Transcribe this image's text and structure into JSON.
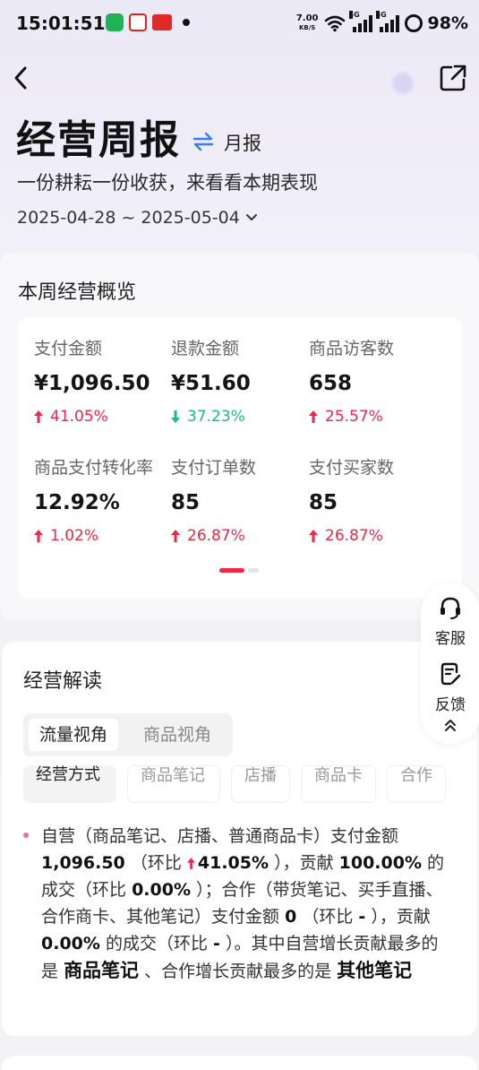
{
  "status_bar": {
    "time": "15:01:51",
    "speed_value": "7.00",
    "speed_unit": "KB/S",
    "network_1": "5G",
    "network_2": "5G",
    "battery": "98%"
  },
  "header": {
    "title": "经营周报",
    "switch_label": "月报",
    "subtitle": "一份耕耘一份收获，来看看本期表现",
    "date_range": "2025-04-28 ~ 2025-05-04"
  },
  "overview": {
    "title": "本周经营概览",
    "metrics": [
      {
        "label": "支付金额",
        "value": "¥1,096.50",
        "change": "41.05%",
        "direction": "up"
      },
      {
        "label": "退款金额",
        "value": "¥51.60",
        "change": "37.23%",
        "direction": "down"
      },
      {
        "label": "商品访客数",
        "value": "658",
        "change": "25.57%",
        "direction": "up"
      },
      {
        "label": "商品支付转化率",
        "value": "12.92%",
        "change": "1.02%",
        "direction": "up"
      },
      {
        "label": "支付订单数",
        "value": "85",
        "change": "26.87%",
        "direction": "up"
      },
      {
        "label": "支付买家数",
        "value": "85",
        "change": "26.87%",
        "direction": "up"
      }
    ],
    "pager": {
      "current": 1,
      "total": 2
    }
  },
  "reading": {
    "title": "经营解读",
    "tabs": [
      "流量视角",
      "商品视角"
    ],
    "active_tab": 0,
    "chips": [
      "经营方式",
      "商品笔记",
      "店播",
      "商品卡",
      "合作"
    ],
    "active_chip": 0,
    "paragraph": {
      "t1": "自营（商品笔记、店播、普通商品卡）支付金额",
      "v1": "1,096.50",
      "t2": "（环比",
      "v2": "41.05%",
      "t3": "），贡献",
      "v3": "100.00%",
      "t4": "的成交（环比",
      "v4": "0.00%",
      "t5": "）；合作（带货笔记、买手直播、合作商卡、其他笔记）支付金额",
      "v5": "0",
      "t6": "（环比",
      "v6": "-",
      "t7": "），贡献",
      "v7": "0.00%",
      "t8": "的成交（环比",
      "v8": "-",
      "t9": "）。其中自营增长贡献最多的是",
      "v9": "商品笔记",
      "t10": "、合作增长贡献最多的是",
      "v10": "其他笔记"
    }
  },
  "float_panel": {
    "service_label": "客服",
    "feedback_label": "反馈"
  },
  "colors": {
    "up": "#ef2745",
    "down": "#1bb98a",
    "accent_blue": "#3d7cf0"
  }
}
